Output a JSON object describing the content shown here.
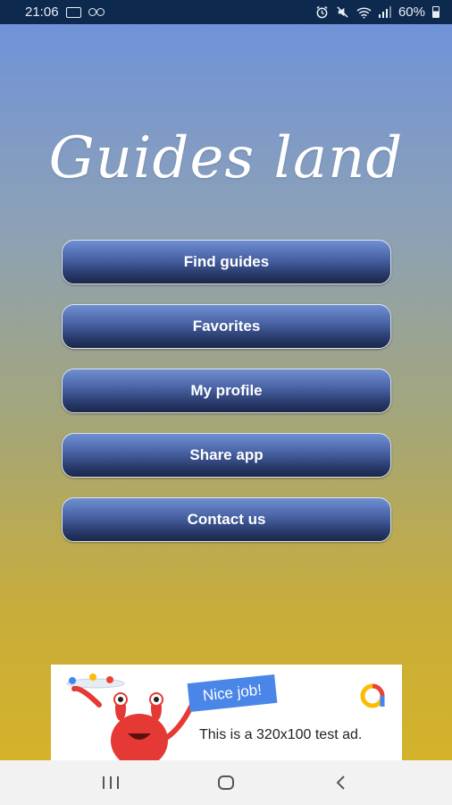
{
  "status_bar": {
    "time": "21:06",
    "battery": "60%",
    "icons": [
      "message-icon",
      "voicemail-icon",
      "alarm-icon",
      "mute-icon",
      "wifi-icon",
      "signal-icon",
      "battery-icon"
    ]
  },
  "app": {
    "title": "Guides land"
  },
  "menu": {
    "items": [
      {
        "label": "Find guides"
      },
      {
        "label": "Favorites"
      },
      {
        "label": "My profile"
      },
      {
        "label": "Share app"
      },
      {
        "label": "Contact us"
      }
    ]
  },
  "ad": {
    "badge": "Nice job!",
    "text": "This is a 320x100 test ad."
  },
  "nav_bar": {
    "icons": [
      "recent-apps-icon",
      "home-icon",
      "back-icon"
    ]
  },
  "colors": {
    "status_bar_bg": "#0d2a4e",
    "gradient_top": "#7093d9",
    "gradient_bottom": "#d4b22a",
    "button_top": "#6f8fd2",
    "button_bottom": "#1a2748",
    "ad_badge": "#4a86e8"
  }
}
